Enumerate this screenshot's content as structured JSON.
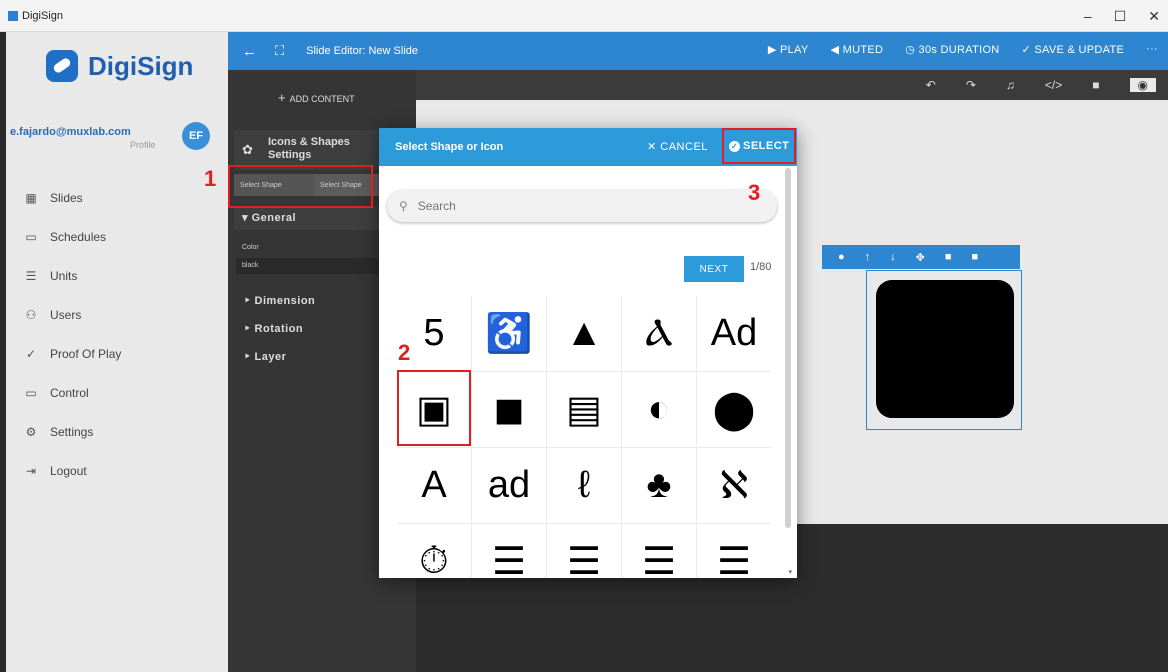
{
  "window": {
    "title": "DigiSign",
    "controls": [
      "–",
      "☐",
      "✕"
    ]
  },
  "sidebar": {
    "logo": "DigiSign",
    "user_email": "e.fajardo@muxlab.com",
    "profile_label": "Profile",
    "avatar_initials": "EF",
    "items": [
      {
        "icon": "▦",
        "label": "Slides"
      },
      {
        "icon": "▭",
        "label": "Schedules"
      },
      {
        "icon": "☰",
        "label": "Units"
      },
      {
        "icon": "⚇",
        "label": "Users"
      },
      {
        "icon": "✓",
        "label": "Proof Of Play"
      },
      {
        "icon": "▭",
        "label": "Control"
      },
      {
        "icon": "⚙",
        "label": "Settings"
      },
      {
        "icon": "⇥",
        "label": "Logout"
      }
    ]
  },
  "topbar": {
    "back": "←",
    "fullscreen": "⛶",
    "title": "Slide Editor: New Slide",
    "play": "▶ PLAY",
    "muted": "◀ MUTED",
    "duration": "◷ 30s DURATION",
    "save": "✓ SAVE & UPDATE",
    "more": "···"
  },
  "panel": {
    "add_content": "ADD CONTENT",
    "settings_title_1": "Icons & Shapes",
    "settings_title_2": "Settings",
    "select_shape_1": "Select Shape",
    "select_shape_2": "Select Shape",
    "general": "▾ General",
    "color_label": "Color",
    "color_value": "black",
    "dimension": "‣ Dimension",
    "rotation": "‣ Rotation",
    "layer": "‣ Layer"
  },
  "canvas_tools": [
    "↶",
    "↷",
    "♫",
    "</>",
    "■",
    "◉"
  ],
  "object_tools": [
    "●",
    "↑",
    "↓",
    "✥",
    "■",
    "■"
  ],
  "modal": {
    "title": "Select Shape or Icon",
    "cancel": "✕ CANCEL",
    "select": "SELECT",
    "search_placeholder": "Search",
    "next": "NEXT",
    "page": "1/80",
    "icons": [
      {
        "name": "500px-icon",
        "glyph": "5"
      },
      {
        "name": "accessible-icon",
        "glyph": "♿"
      },
      {
        "name": "accusoft-icon",
        "glyph": "▲"
      },
      {
        "name": "acquisitions-incorporated-icon",
        "glyph": "Ⲁ"
      },
      {
        "name": "ad-icon",
        "glyph": "Ad"
      },
      {
        "name": "address-book-outline-icon",
        "glyph": "▣"
      },
      {
        "name": "address-book-icon",
        "glyph": "◼"
      },
      {
        "name": "address-card-icon",
        "glyph": "▤"
      },
      {
        "name": "adjust-icon",
        "glyph": "◐"
      },
      {
        "name": "adn-icon",
        "glyph": "⬤"
      },
      {
        "name": "adobe-icon",
        "glyph": "A"
      },
      {
        "name": "adversal-icon",
        "glyph": "ad"
      },
      {
        "name": "affiliatetheme-icon",
        "glyph": "ℓ"
      },
      {
        "name": "air-freshener-icon",
        "glyph": "♣"
      },
      {
        "name": "airbnb-icon",
        "glyph": "ℵ"
      },
      {
        "name": "alarm-clock-icon",
        "glyph": "⏱"
      },
      {
        "name": "align-center-icon",
        "glyph": "☰"
      },
      {
        "name": "align-justify-icon",
        "glyph": "☰"
      },
      {
        "name": "align-left-icon",
        "glyph": "☰"
      },
      {
        "name": "align-right-icon",
        "glyph": "☰"
      }
    ]
  },
  "annotations": [
    "1",
    "2",
    "3"
  ]
}
